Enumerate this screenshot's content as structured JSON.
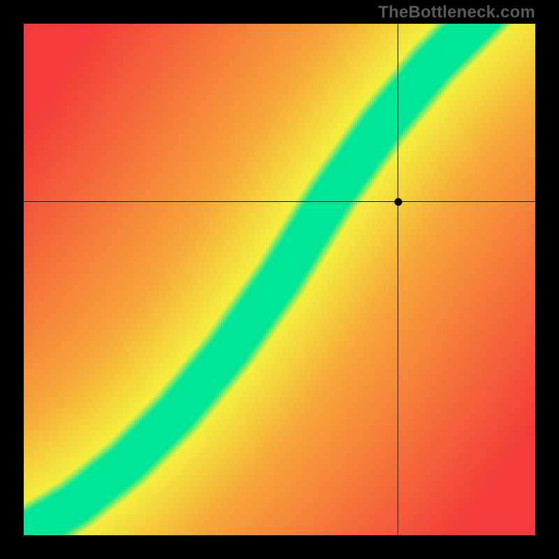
{
  "watermark": "TheBottleneck.com",
  "chart_data": {
    "type": "heatmap",
    "title": "",
    "xlabel": "",
    "ylabel": "",
    "xlim": [
      0,
      1
    ],
    "ylim": [
      0,
      1
    ],
    "crosshair": {
      "x": 0.732,
      "y": 0.652
    },
    "marker": {
      "x": 0.732,
      "y": 0.652
    },
    "optimal_curve": {
      "description": "Green optimal band center (normalized 0..1, y measured from bottom)",
      "points": [
        {
          "x": 0.0,
          "y": 0.0
        },
        {
          "x": 0.1,
          "y": 0.06
        },
        {
          "x": 0.2,
          "y": 0.14
        },
        {
          "x": 0.3,
          "y": 0.24
        },
        {
          "x": 0.4,
          "y": 0.36
        },
        {
          "x": 0.5,
          "y": 0.5
        },
        {
          "x": 0.6,
          "y": 0.66
        },
        {
          "x": 0.7,
          "y": 0.8
        },
        {
          "x": 0.8,
          "y": 0.92
        },
        {
          "x": 0.88,
          "y": 1.0
        }
      ]
    },
    "band_width_normalized": 0.055,
    "colors": {
      "optimal": "#00E596",
      "near": "#F4EF3E",
      "mid": "#F7A63A",
      "far": "#F33B3B"
    },
    "value_explanation": "Color encodes bottleneck severity: green = balanced (0%), yellow ≈ 10-20%, orange ≈ 30-50%, red ≥ 60%."
  }
}
